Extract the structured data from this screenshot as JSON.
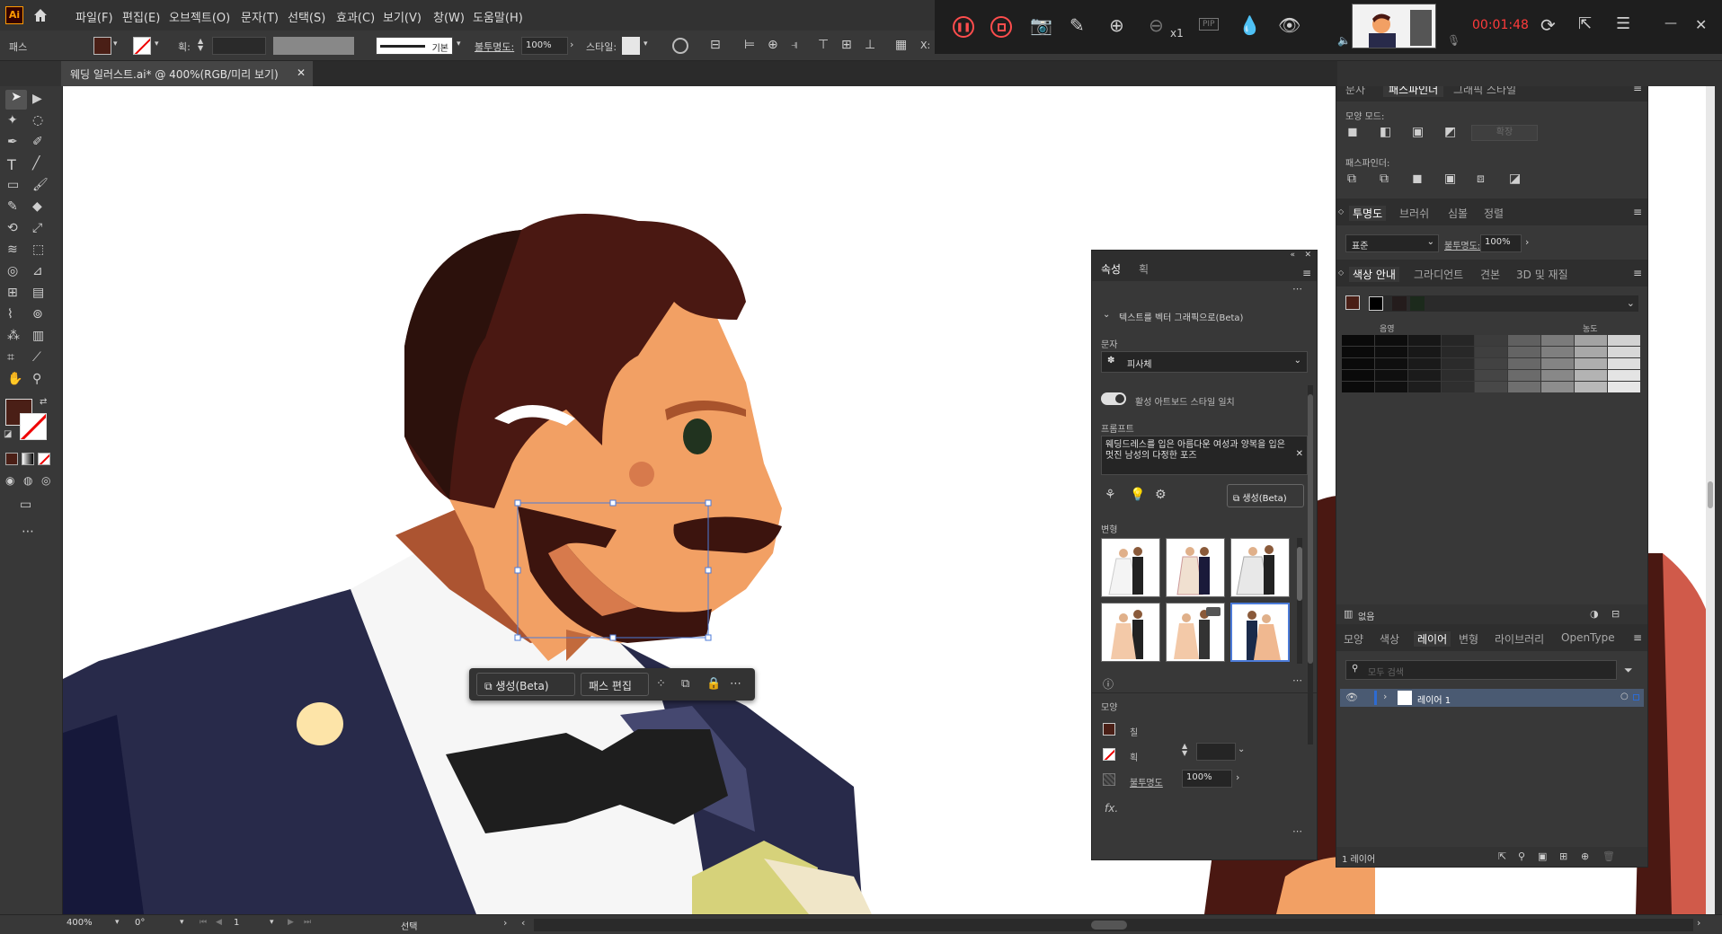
{
  "app": {
    "logo": "Ai",
    "home_icon": "home-icon"
  },
  "menu": [
    "파일(F)",
    "편집(E)",
    "오브젝트(O)",
    "문자(T)",
    "선택(S)",
    "효과(C)",
    "보기(V)",
    "창(W)",
    "도움말(H)"
  ],
  "control": {
    "path_label": "패스",
    "stroke_label": "획:",
    "stroke_style": "기본",
    "opacity_label": "불투명도:",
    "opacity": "100%",
    "style_label": "스타일:",
    "x_label": "X:"
  },
  "document": {
    "tab_title": "웨딩 일러스트.ai* @ 400%(RGB/미리 보기)"
  },
  "recorder": {
    "zoom": "x1",
    "pip": "PIP",
    "time": "00:01:48"
  },
  "status": {
    "zoom": "400%",
    "angle": "0°",
    "artboard": "1",
    "mode": "선택"
  },
  "context_bar": {
    "generate": "생성(Beta)",
    "edit_path": "패스 편집"
  },
  "properties": {
    "tabs": [
      "속성",
      "획"
    ],
    "section": "텍스트를 벡터 그래픽으로(Beta)",
    "type_label": "문자",
    "type_value": "피사체",
    "toggle_label": "활성 아트보드 스타일 일치",
    "prompt_label": "프롬프트",
    "prompt": "웨딩드레스를 입은 아름다운 여성과 양복을 입은 멋진 남성의 다정한 포즈",
    "generate": "생성(Beta)",
    "variations_label": "변형",
    "appearance_label": "모양",
    "fill_label": "칠",
    "stroke_label": "획",
    "opacity_label": "불투명도",
    "opacity": "100%",
    "fx": "fx."
  },
  "pathfinder": {
    "tabs": [
      "문자",
      "패스파인더",
      "그래픽 스타일"
    ],
    "shape_modes": "모양 모드:",
    "expand": "확장",
    "pathfinders": "패스파인더:"
  },
  "transparency": {
    "tabs": [
      "투명도",
      "브러쉬",
      "심볼",
      "정렬"
    ],
    "mode": "표준",
    "opacity_label": "불투명도:",
    "opacity": "100%"
  },
  "color_guide": {
    "tabs": [
      "색상 안내",
      "그라디언트",
      "견본",
      "3D 및 재질"
    ],
    "shade": "음영",
    "tint": "농도",
    "none": "없음"
  },
  "layers": {
    "tabs": [
      "모양",
      "색상",
      "레이어",
      "변형",
      "라이브러리",
      "OpenType"
    ],
    "search_placeholder": "모두 검색",
    "layer_name": "레이어 1",
    "count": "1 레이어"
  },
  "colors": {
    "fill": "#4a1f16",
    "accent": "#2d6bd2",
    "skin": "#f2a064",
    "hair": "#4a1812",
    "suit": "#282a4a",
    "rec_time": "#ff3b3b"
  }
}
